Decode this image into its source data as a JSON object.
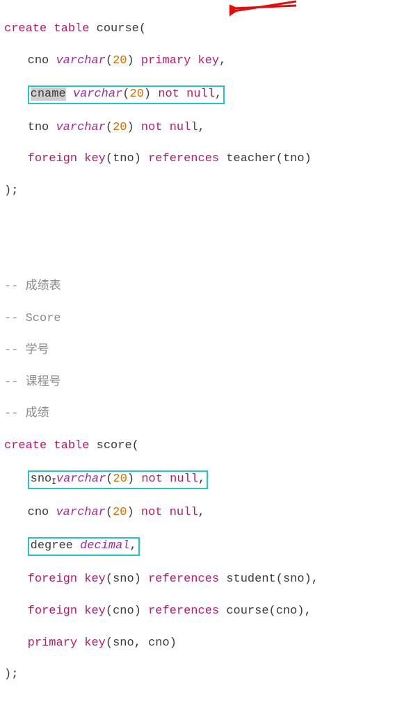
{
  "course": {
    "create": "create",
    "table": "table",
    "name": "course",
    "open": "(",
    "close": ");",
    "l1": {
      "col": "cno",
      "typ": "varchar",
      "open": "(",
      "n": "20",
      "close": ")",
      "pk": "primary key",
      "comma": ","
    },
    "l2": {
      "col": "cname",
      "typ": "varchar",
      "open": "(",
      "n": "20",
      "close": ")",
      "nn": "not null",
      "comma": ","
    },
    "l3": {
      "col": "tno",
      "typ": "varchar",
      "open": "(",
      "n": "20",
      "close": ")",
      "nn": "not null",
      "comma": ","
    },
    "l4": {
      "fk": "foreign key",
      "open": "(",
      "col": "tno",
      "close": ")",
      "ref": "references",
      "t": "teacher",
      "open2": "(",
      "col2": "tno",
      "close2": ")"
    }
  },
  "comments": {
    "c1": "-- 成绩表",
    "c2": "-- Score",
    "c3": "-- 学号",
    "c4": "-- 课程号",
    "c5": "-- 成绩"
  },
  "score": {
    "create": "create",
    "table": "table",
    "name": "score",
    "open": "(",
    "close": ");",
    "l1": {
      "col": "sno",
      "typ": "varchar",
      "open": "(",
      "n": "20",
      "close": ")",
      "nn": "not null",
      "comma": ","
    },
    "l2": {
      "col": "cno",
      "typ": "varchar",
      "open": "(",
      "n": "20",
      "close": ")",
      "nn": "not null",
      "comma": ","
    },
    "l3": {
      "col": "degree",
      "typ": "decimal",
      "comma": ","
    },
    "l4": {
      "fk": "foreign key",
      "open": "(",
      "col": "sno",
      "close": ")",
      "ref": "references",
      "t": "student",
      "open2": "(",
      "col2": "sno",
      "close2": ")",
      "comma": ","
    },
    "l5": {
      "fk": "foreign key",
      "open": "(",
      "col": "cno",
      "close": ")",
      "ref": "references",
      "t": "course",
      "open2": "(",
      "col2": "cno",
      "close2": ")",
      "comma": ","
    },
    "l6": {
      "pk": "primary key",
      "open": "(",
      "c1": "sno",
      "comma": ", ",
      "c2": "cno",
      "close": ")"
    }
  }
}
